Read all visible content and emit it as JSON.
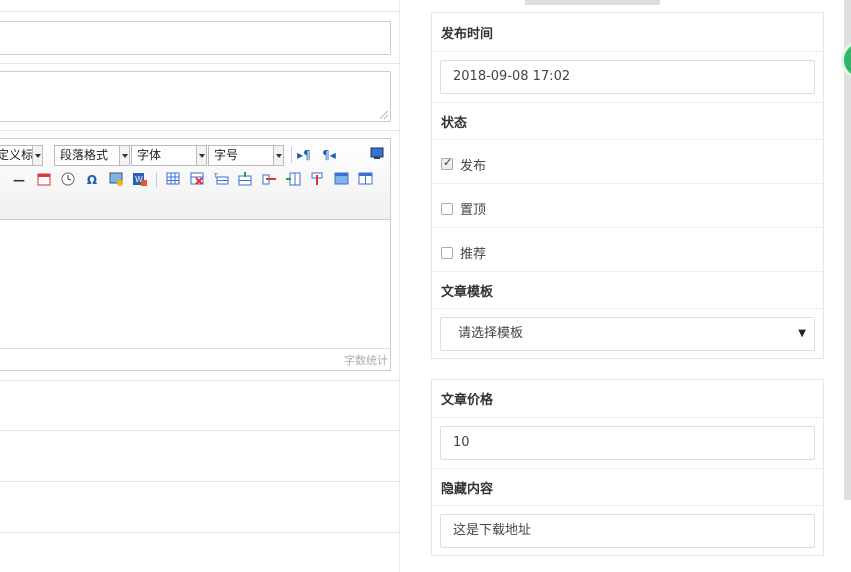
{
  "editor": {
    "toolbar": {
      "custom_heading": "定义标题",
      "paragraph_format": "段落格式",
      "font_family": "字体",
      "font_size": "字号",
      "icons": [
        "ltr-icon",
        "rtl-icon",
        "preview-icon",
        "horizontal-rule-icon",
        "date-icon",
        "time-icon",
        "special-char-icon",
        "image-icon",
        "word-import-icon",
        "insert-table-icon",
        "delete-table-icon",
        "insert-caption-icon",
        "insert-row-icon",
        "delete-row-icon",
        "insert-col-icon",
        "delete-col-icon",
        "merge-cells-icon",
        "split-cells-icon"
      ]
    },
    "word_count_label": "字数统计"
  },
  "sidebar": {
    "publish_time": {
      "label": "发布时间",
      "value": "2018-09-08 17:02"
    },
    "status": {
      "label": "状态",
      "options": [
        {
          "label": "发布",
          "checked": true
        },
        {
          "label": "置顶",
          "checked": false
        },
        {
          "label": "推荐",
          "checked": false
        }
      ]
    },
    "template": {
      "label": "文章模板",
      "selected": "请选择模板"
    },
    "price": {
      "label": "文章价格",
      "value": "10"
    },
    "hidden_content": {
      "label": "隐藏内容",
      "value": "这是下载地址"
    }
  }
}
